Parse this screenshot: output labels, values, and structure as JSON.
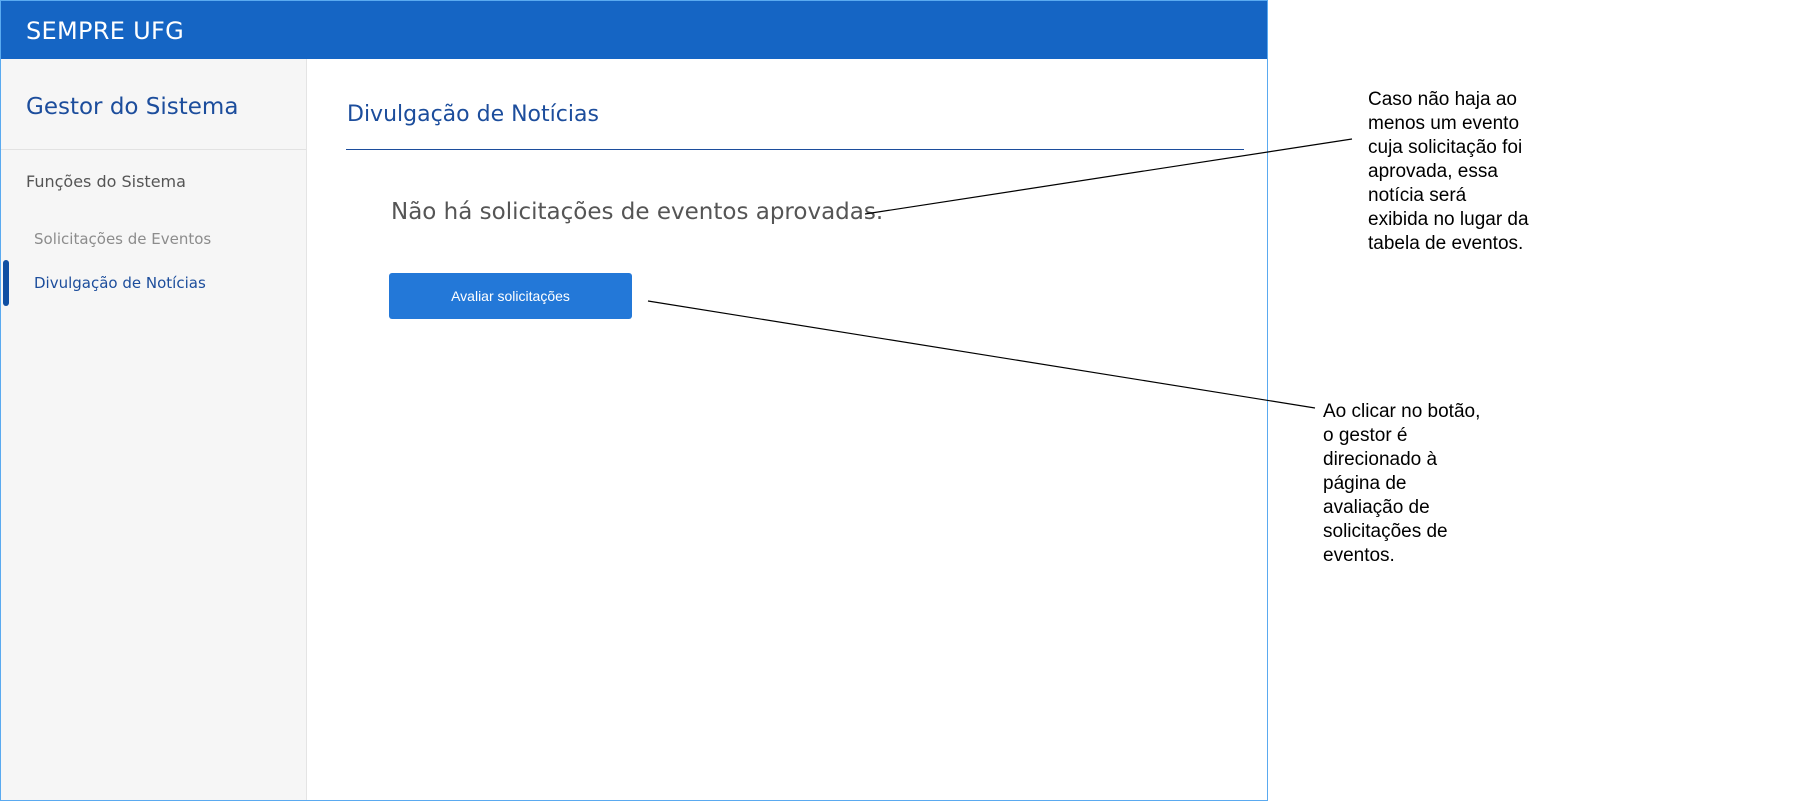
{
  "window": {
    "title": "SEMPRE UFG"
  },
  "sidebar": {
    "title": "Gestor do Sistema",
    "section_label": "Funções do Sistema",
    "items": [
      {
        "label": "Solicitações de Eventos",
        "active": false
      },
      {
        "label": "Divulgação de Notícias",
        "active": true
      }
    ]
  },
  "main": {
    "page_title": "Divulgação de Notícias",
    "empty_message": "Não há solicitações de eventos aprovadas.",
    "button_label": "Avaliar solicitações"
  },
  "annotations": [
    {
      "text": "Caso não haja ao\nmenos um evento\ncuja solicitação foi\naprovada, essa\nnotícia será\nexibida no lugar da\ntabela de eventos."
    },
    {
      "text": "Ao clicar no botão,\no gestor é\ndirecionado à\npágina de\navaliação de\nsolicitações de\neventos."
    }
  ],
  "colors": {
    "header_blue": "#1565c4",
    "accent_blue": "#1c4d9c",
    "button_blue": "#2378d8",
    "sidebar_bg": "#f6f6f6",
    "frame_border": "#5aaaf0"
  }
}
